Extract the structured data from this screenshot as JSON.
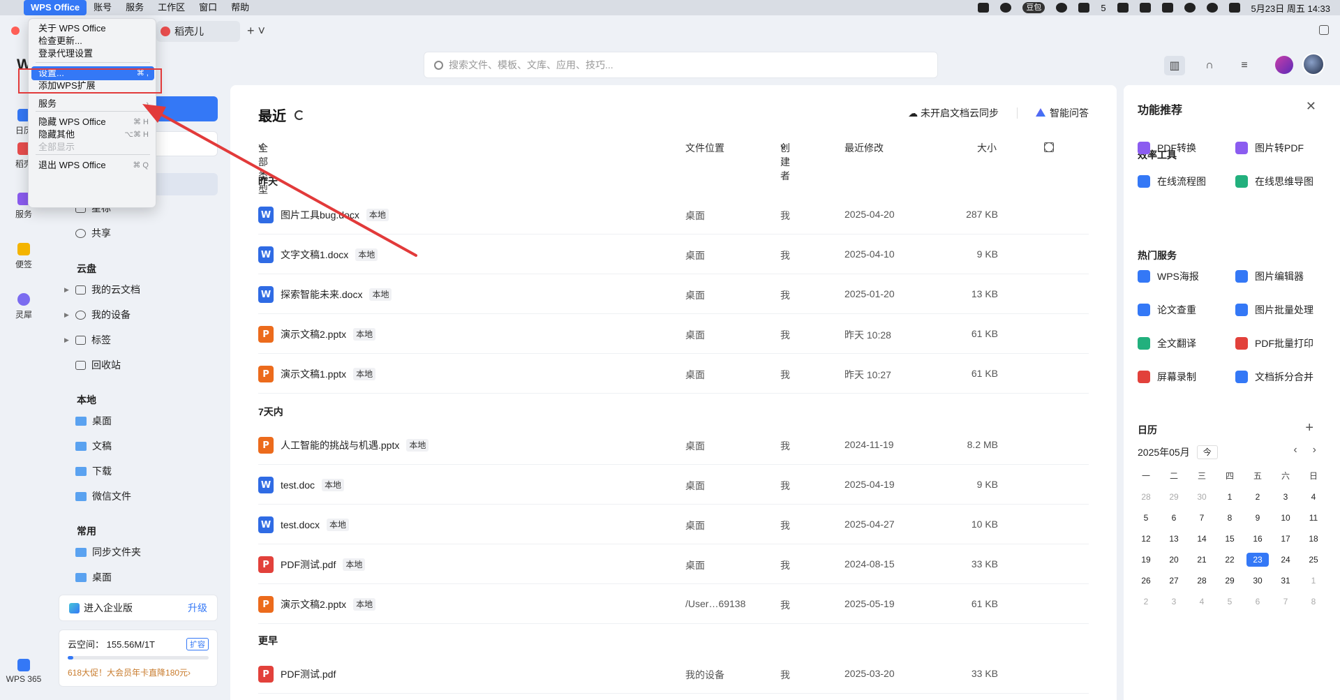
{
  "menubar": {
    "app": "WPS Office",
    "items": [
      "账号",
      "服务",
      "工作区",
      "窗口",
      "帮助"
    ],
    "tray": {
      "pill": "豆包",
      "count": "5",
      "datetime": "5月23日 周五  14:33"
    }
  },
  "tabs": {
    "tab1": "稻壳儿"
  },
  "search": {
    "placeholder": "搜索文件、模板、文库、应用、技巧..."
  },
  "rail": {
    "logo": "W",
    "items": [
      "日历",
      "稻壳",
      "服务",
      "便签",
      "灵犀"
    ],
    "bottom": "WPS 365"
  },
  "sidebar": {
    "partial_top": "星标",
    "share": "共享",
    "cloud_title": "云盘",
    "cloud_items": [
      "我的云文档",
      "我的设备",
      "标签",
      "回收站"
    ],
    "local_title": "本地",
    "local_items": [
      "桌面",
      "文稿",
      "下载",
      "微信文件"
    ],
    "common_title": "常用",
    "common_items": [
      "同步文件夹",
      "桌面"
    ],
    "enterprise": "进入企业版",
    "upgrade": "升级",
    "cloud_space": "云空间：  155.56M/1T",
    "expand": "扩容",
    "usage": 0.04,
    "promo": "618大促！大会员年卡直降180元"
  },
  "main": {
    "title": "最近",
    "sync": "未开启文档云同步",
    "ai": "智能问答",
    "headers": {
      "type": "全部类型",
      "loc": "文件位置",
      "creator": "创建者",
      "mod": "最近修改",
      "size": "大小"
    },
    "sections": [
      "昨天",
      "7天内",
      "更早"
    ],
    "local_tag": "本地",
    "rows": [
      {
        "name": "图片工具bug.docx",
        "kind": "W",
        "loc": "桌面",
        "creator": "我",
        "mod": "2025-04-20",
        "size": "287 KB"
      },
      {
        "name": "文字文稿1.docx",
        "kind": "W",
        "loc": "桌面",
        "creator": "我",
        "mod": "2025-04-10",
        "size": "9 KB"
      },
      {
        "name": "探索智能未来.docx",
        "kind": "W",
        "loc": "桌面",
        "creator": "我",
        "mod": "2025-01-20",
        "size": "13 KB"
      },
      {
        "name": "演示文稿2.pptx",
        "kind": "P",
        "loc": "桌面",
        "creator": "我",
        "mod": "昨天 10:28",
        "size": "61 KB"
      },
      {
        "name": "演示文稿1.pptx",
        "kind": "P",
        "loc": "桌面",
        "creator": "我",
        "mod": "昨天 10:27",
        "size": "61 KB"
      },
      {
        "name": "人工智能的挑战与机遇.pptx",
        "kind": "P",
        "loc": "桌面",
        "creator": "我",
        "mod": "2024-11-19",
        "size": "8.2 MB"
      },
      {
        "name": "test.doc",
        "kind": "W",
        "loc": "桌面",
        "creator": "我",
        "mod": "2025-04-19",
        "size": "9 KB"
      },
      {
        "name": "test.docx",
        "kind": "W",
        "loc": "桌面",
        "creator": "我",
        "mod": "2025-04-27",
        "size": "10 KB"
      },
      {
        "name": "PDF测试.pdf",
        "kind": "PDF",
        "loc": "桌面",
        "creator": "我",
        "mod": "2024-08-15",
        "size": "33 KB"
      },
      {
        "name": "演示文稿2.pptx",
        "kind": "P",
        "loc": "/User…69138",
        "creator": "我",
        "mod": "2025-05-19",
        "size": "61 KB"
      },
      {
        "name": "PDF测试.pdf",
        "kind": "PDF",
        "loc": "我的设备",
        "creator": "我",
        "mod": "2025-03-20",
        "size": "33 KB"
      }
    ]
  },
  "rpanel": {
    "title": "功能推荐",
    "eff_title": "效率工具",
    "eff": [
      "PDF转换",
      "图片转PDF",
      "在线流程图",
      "在线思维导图"
    ],
    "hot_title": "热门服务",
    "hot": [
      "WPS海报",
      "图片编辑器",
      "论文查重",
      "图片批量处理",
      "全文翻译",
      "PDF批量打印",
      "屏幕录制",
      "文档拆分合并"
    ],
    "cal_title": "日历",
    "month": "2025年05月",
    "today_btn": "今",
    "weekdays": [
      "一",
      "二",
      "三",
      "四",
      "五",
      "六",
      "日"
    ],
    "days": [
      "28",
      "29",
      "30",
      "1",
      "2",
      "3",
      "4",
      "5",
      "6",
      "7",
      "8",
      "9",
      "10",
      "11",
      "12",
      "13",
      "14",
      "15",
      "16",
      "17",
      "18",
      "19",
      "20",
      "21",
      "22",
      "23",
      "24",
      "25",
      "26",
      "27",
      "28",
      "29",
      "30",
      "31",
      "1",
      "2",
      "3",
      "4",
      "5",
      "6",
      "7",
      "8"
    ],
    "today": "23"
  },
  "menu": {
    "items": [
      {
        "label": "关于 WPS Office",
        "sc": ""
      },
      {
        "label": "检查更新...",
        "sc": ""
      },
      {
        "label": "登录代理设置",
        "sc": ""
      },
      {
        "label": "设置...",
        "sc": "⌘ ,"
      },
      {
        "label": "添加WPS扩展",
        "sc": ""
      },
      {
        "label": "服务",
        "sc": "›"
      },
      {
        "label": "隐藏 WPS Office",
        "sc": "⌘ H"
      },
      {
        "label": "隐藏其他",
        "sc": "⌥⌘ H"
      },
      {
        "label": "全部显示",
        "sc": ""
      },
      {
        "label": "退出 WPS Office",
        "sc": "⌘ Q"
      }
    ]
  },
  "colors": {
    "accent": "#3478f6",
    "highlight": "#e23a3a"
  }
}
